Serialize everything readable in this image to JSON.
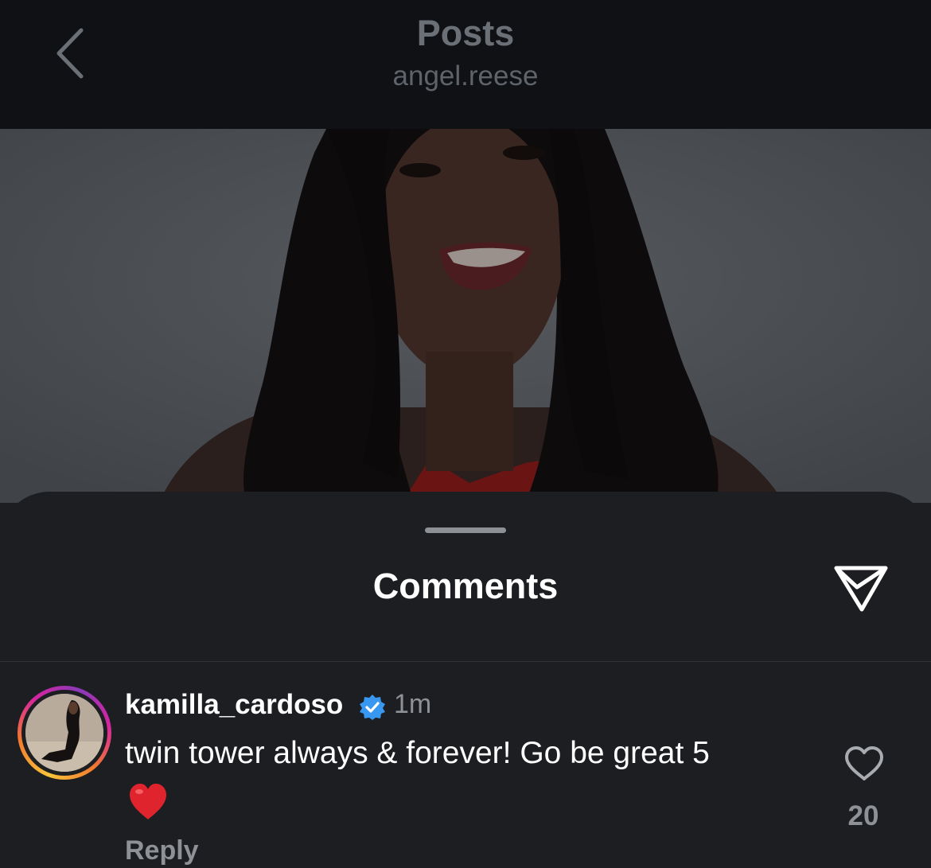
{
  "header": {
    "title": "Posts",
    "subtitle": "angel.reese",
    "back_icon": "chevron-left-icon"
  },
  "post": {
    "image_description_icon": "photo",
    "backdrop_color": "#4a4d52"
  },
  "comments_sheet": {
    "title": "Comments",
    "send_icon": "paper-plane-icon"
  },
  "comment": {
    "username": "kamilla_cardoso",
    "verified": true,
    "time": "1m",
    "text": "twin tower always & forever! Go be great 5",
    "emoji": "red-heart",
    "reply_label": "Reply",
    "like_count": "20"
  },
  "colors": {
    "background": "#1c1e22",
    "header_background": "#0f1114",
    "verified_blue": "#3897f0",
    "heart_red": "#e0242d"
  }
}
